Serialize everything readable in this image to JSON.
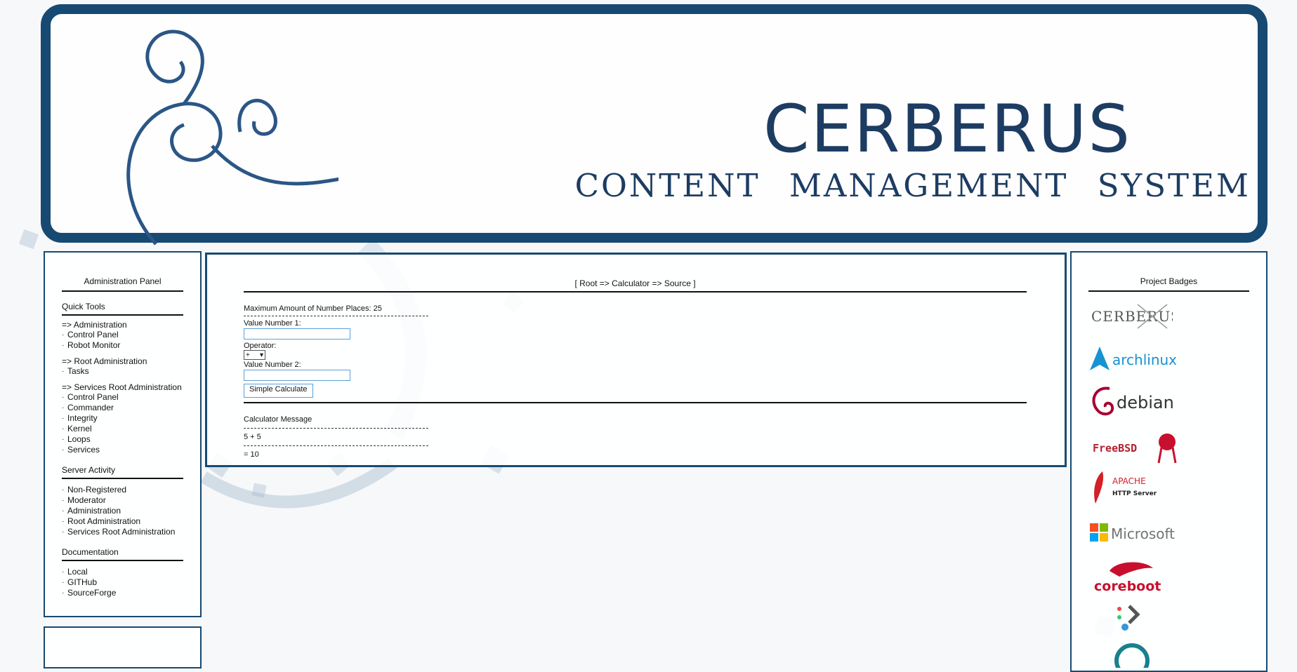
{
  "banner": {
    "title": "CERBERUS",
    "subtitle": "CONTENT MANAGEMENT SYSTEM"
  },
  "left_panel": {
    "title": "Administration Panel",
    "quick_tools": {
      "title": "Quick Tools",
      "groups": [
        {
          "head": "=> Administration",
          "items": [
            "Control Panel",
            "Robot Monitor"
          ]
        },
        {
          "head": "=> Root Administration",
          "items": [
            "Tasks"
          ]
        },
        {
          "head": "=> Services Root Administration",
          "items": [
            "Control Panel",
            "Commander",
            "Integrity",
            "Kernel",
            "Loops",
            "Services"
          ]
        }
      ]
    },
    "server_activity": {
      "title": "Server Activity",
      "items": [
        "Non-Registered",
        "Moderator",
        "Administration",
        "Root Administration",
        "Services Root Administration"
      ]
    },
    "documentation": {
      "title": "Documentation",
      "items": [
        "Local",
        "GITHub",
        "SourceForge"
      ]
    }
  },
  "main": {
    "breadcrumb": "[ Root => Calculator => Source ]",
    "max_places": "Maximum Amount of Number Places: 25",
    "value1_label": "Value Number 1:",
    "value1": "",
    "operator_label": "Operator:",
    "operator_value": "+",
    "value2_label": "Value Number 2:",
    "value2": "",
    "submit_label": "Simple Calculate",
    "message_title": "Calculator Message",
    "expression": "5 + 5",
    "result": "= 10"
  },
  "right_panel": {
    "title": "Project Badges",
    "badges": [
      "CERBERUS",
      "archlinux",
      "debian",
      "FreeBSD",
      "APACHE",
      "HTTP Server",
      "Microsoft",
      "coreboot"
    ]
  },
  "colors": {
    "frame": "#174a72",
    "banner_text": "#1d3c62",
    "field_border": "#5aa0d8"
  }
}
